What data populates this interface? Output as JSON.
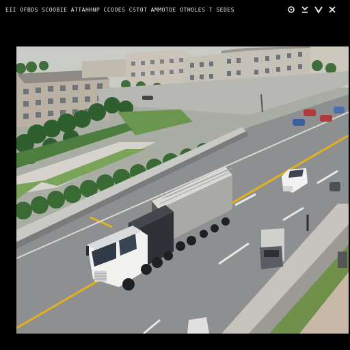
{
  "window": {
    "title": "EII OFBDS SCOOBIE ATTAHHNP CCOOES CSTOT AMMOTOE OTHOLES T SEDES"
  },
  "toolbar": {
    "icons": [
      "settings-icon",
      "download-icon",
      "chevron-down-icon",
      "close-icon"
    ]
  },
  "scene": {
    "description_label": "",
    "colors": {
      "asphalt": "#8d8f91",
      "lane_yellow": "#e2b21e",
      "grass": "#5f8f48",
      "building": "#c8c3b8"
    }
  }
}
